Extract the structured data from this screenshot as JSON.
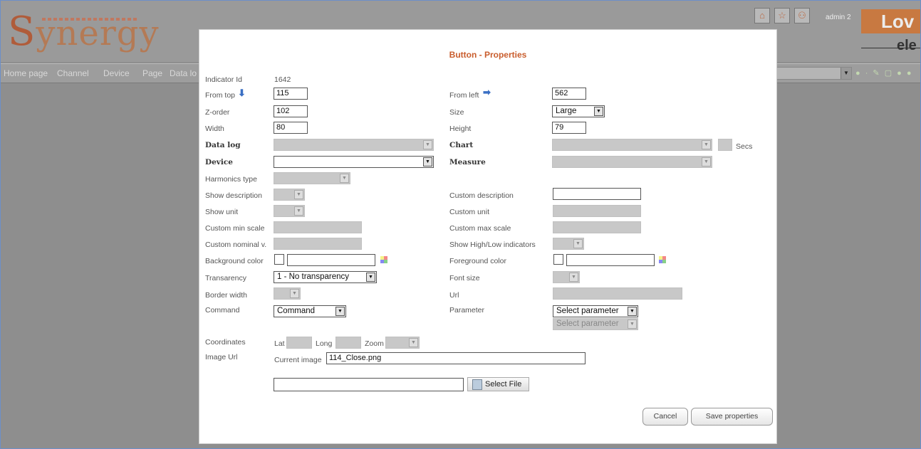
{
  "app": {
    "logo": "Synergy",
    "user": "admin 2",
    "brand": "Lov",
    "brand_sub": "ele",
    "nav": [
      "Home page",
      "Channel",
      "Device",
      "Page",
      "Data lo"
    ],
    "icons": [
      "home-icon",
      "star-icon",
      "user-icon"
    ]
  },
  "dialog": {
    "title": "Button - Properties",
    "indicator_id_label": "Indicator Id",
    "indicator_id": "1642",
    "from_top_label": "From top",
    "from_top": "115",
    "from_left_label": "From left",
    "from_left": "562",
    "z_order_label": "Z-order",
    "z_order": "102",
    "size_label": "Size",
    "size": "Large",
    "width_label": "Width",
    "width": "80",
    "height_label": "Height",
    "height": "79",
    "data_log_label": "Data log",
    "chart_label": "Chart",
    "secs_label": "Secs",
    "device_label": "Device",
    "measure_label": "Measure",
    "harmonics_label": "Harmonics type",
    "show_description_label": "Show description",
    "custom_description_label": "Custom description",
    "show_unit_label": "Show unit",
    "custom_unit_label": "Custom unit",
    "custom_min_label": "Custom min scale",
    "custom_max_label": "Custom max scale",
    "custom_nominal_label": "Custom nominal v.",
    "show_highlow_label": "Show High/Low indicators",
    "background_color_label": "Background color",
    "foreground_color_label": "Foreground color",
    "transparency_label": "Transarency",
    "transparency": "1 - No transparency",
    "font_size_label": "Font size",
    "border_width_label": "Border width",
    "url_label": "Url",
    "command_label": "Command",
    "command": "Command",
    "parameter_label": "Parameter",
    "parameter": "Select parameter",
    "parameter2": "Select parameter",
    "coordinates_label": "Coordinates",
    "lat_label": "Lat",
    "long_label": "Long",
    "zoom_label": "Zoom",
    "image_url_label": "Image Url",
    "current_image_label": "Current image",
    "current_image": "114_Close.png",
    "select_file_label": "Select File",
    "cancel_label": "Cancel",
    "save_label": "Save properties"
  }
}
